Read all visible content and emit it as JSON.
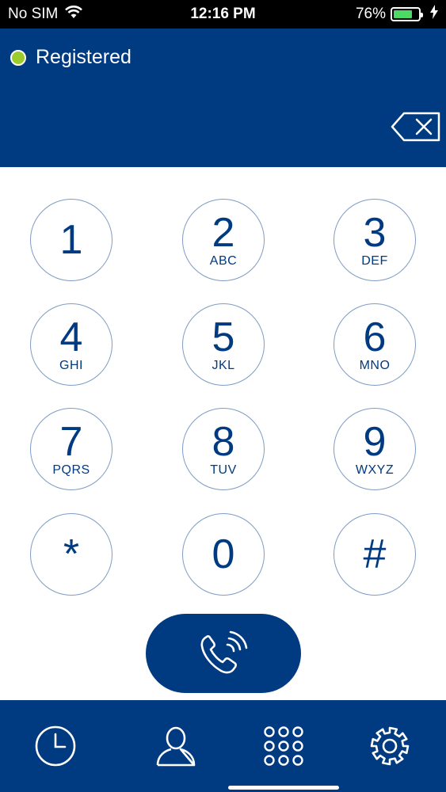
{
  "status_bar": {
    "carrier": "No SIM",
    "time": "12:16 PM",
    "battery_percent": "76%",
    "battery_level": 0.76
  },
  "header": {
    "registration_status": "Registered",
    "status_color": "#9ccc2c"
  },
  "keypad": {
    "keys": [
      {
        "digit": "1",
        "letters": ""
      },
      {
        "digit": "2",
        "letters": "ABC"
      },
      {
        "digit": "3",
        "letters": "DEF"
      },
      {
        "digit": "4",
        "letters": "GHI"
      },
      {
        "digit": "5",
        "letters": "JKL"
      },
      {
        "digit": "6",
        "letters": "MNO"
      },
      {
        "digit": "7",
        "letters": "PQRS"
      },
      {
        "digit": "8",
        "letters": "TUV"
      },
      {
        "digit": "9",
        "letters": "WXYZ"
      },
      {
        "digit": "*",
        "letters": ""
      },
      {
        "digit": "0",
        "letters": ""
      },
      {
        "digit": "#",
        "letters": ""
      }
    ]
  },
  "tabs": [
    {
      "icon": "clock-icon",
      "name": "recents"
    },
    {
      "icon": "person-icon",
      "name": "contacts"
    },
    {
      "icon": "keypad-grid-icon",
      "name": "keypad"
    },
    {
      "icon": "gear-icon",
      "name": "settings"
    }
  ],
  "colors": {
    "brand": "#003a80",
    "key_border": "#7e9cc4",
    "battery_fill": "#4cd964"
  }
}
